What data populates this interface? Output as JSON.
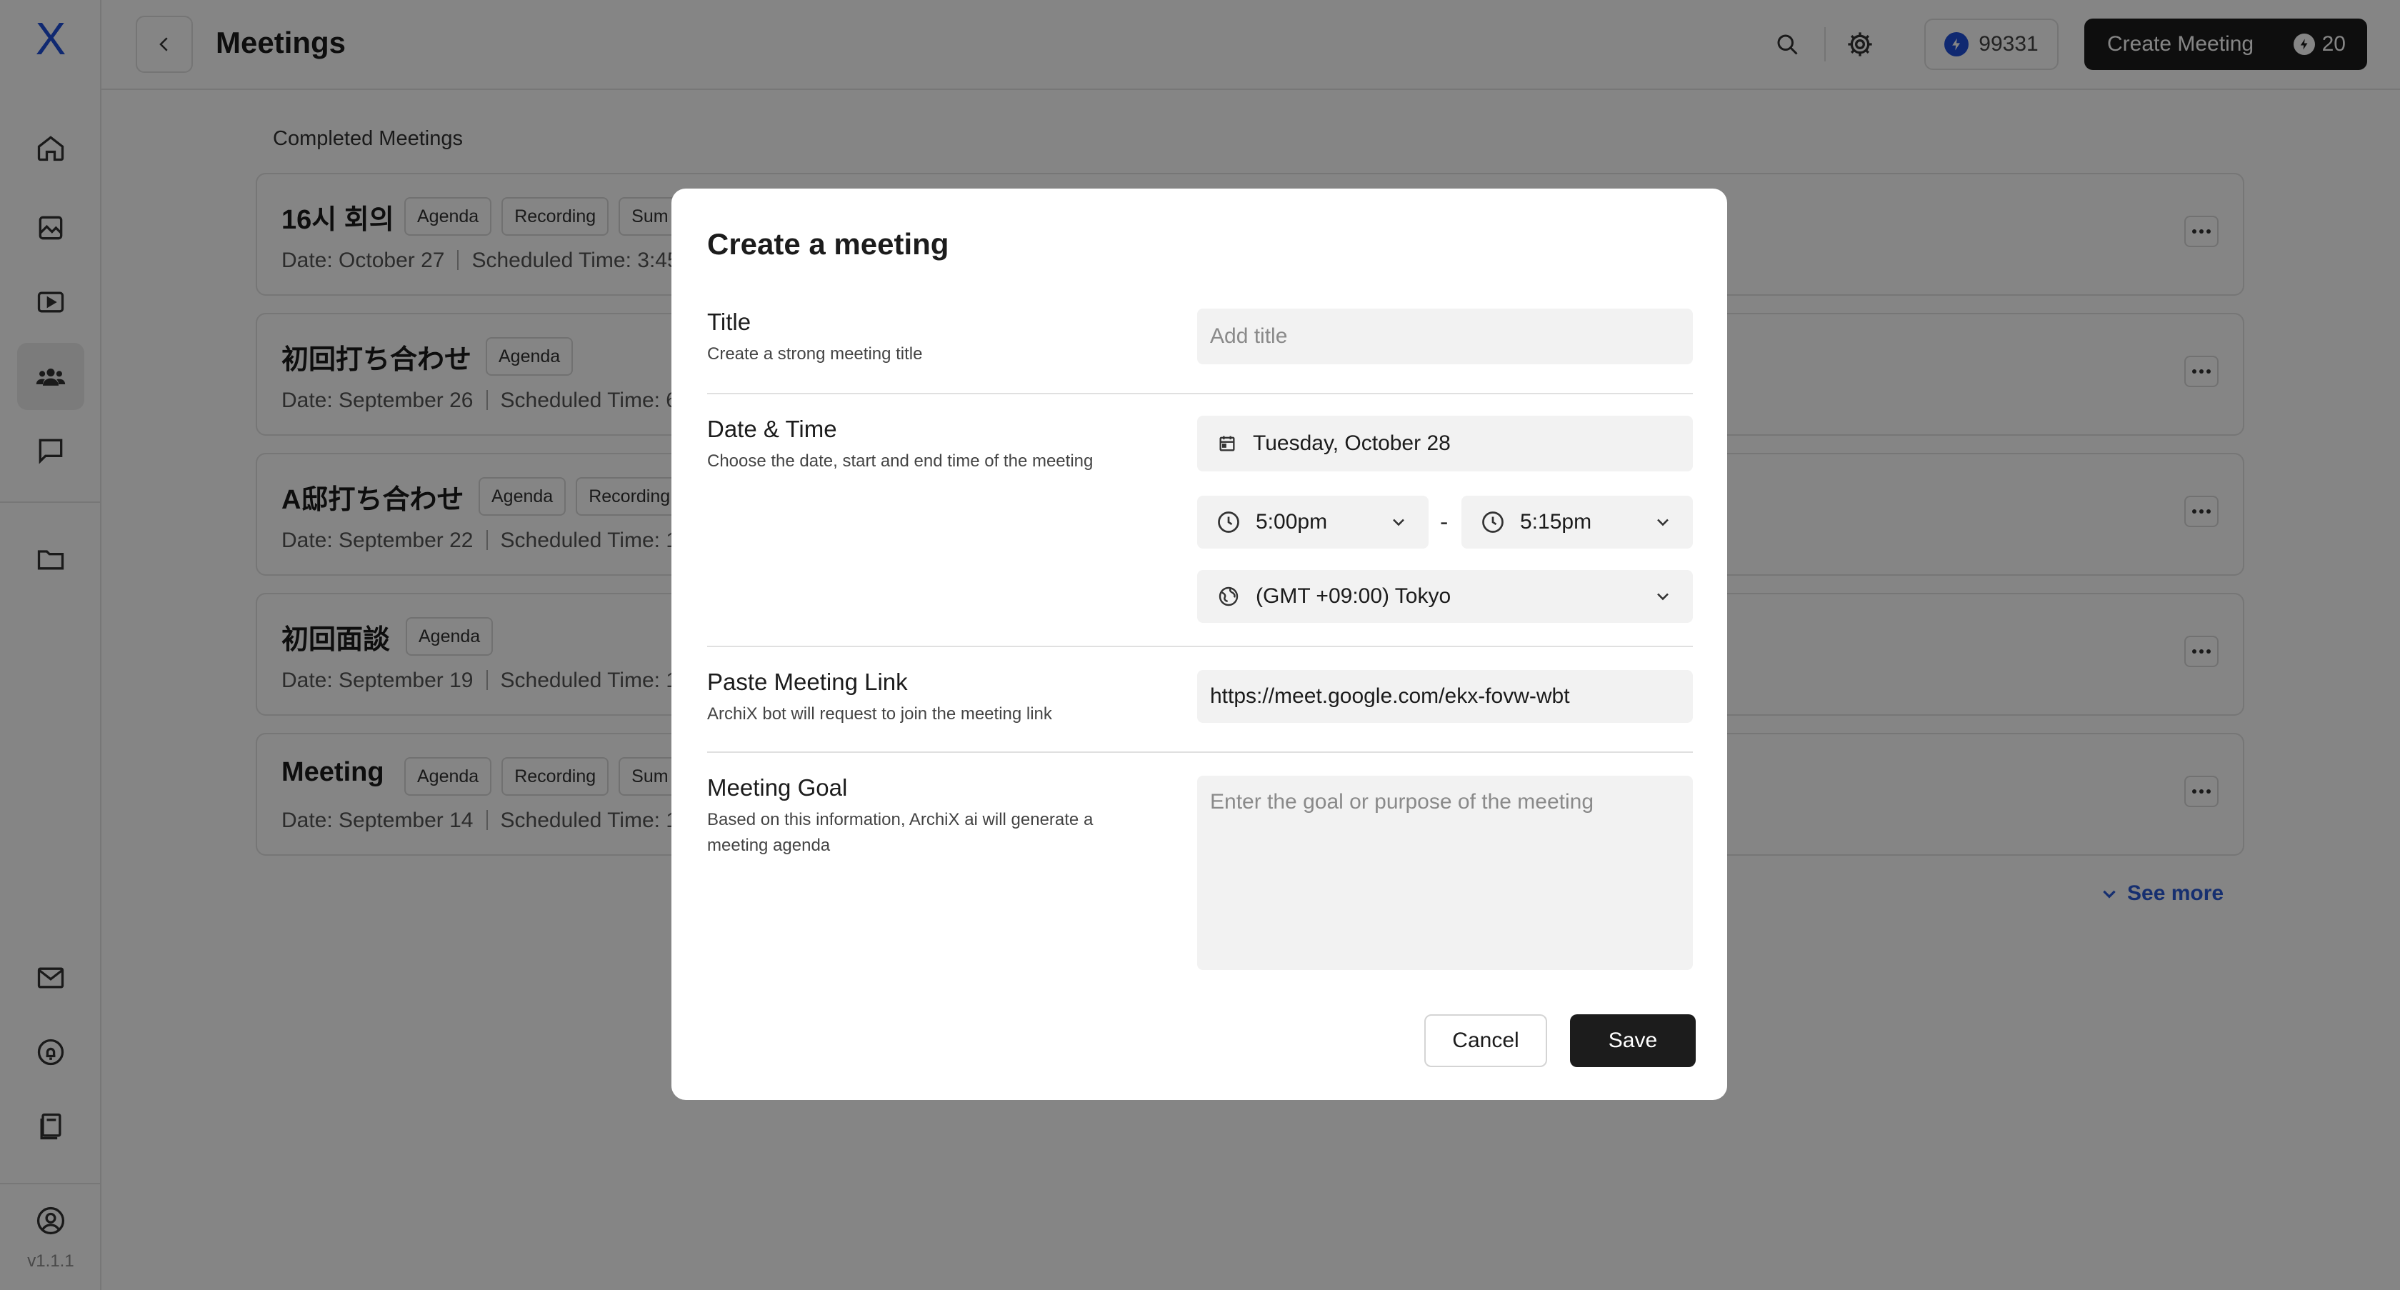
{
  "app": {
    "logo": "X",
    "version": "v1.1.1"
  },
  "sidebar": {
    "items": [
      {
        "name": "home",
        "icon": "home-icon"
      },
      {
        "name": "images",
        "icon": "image-icon"
      },
      {
        "name": "videos",
        "icon": "play-icon"
      },
      {
        "name": "meetings",
        "icon": "users-icon",
        "active": true
      },
      {
        "name": "chat",
        "icon": "chat-icon"
      },
      {
        "name": "files",
        "icon": "folder-icon"
      },
      {
        "name": "mail",
        "icon": "mail-icon"
      },
      {
        "name": "notifications",
        "icon": "bell-icon"
      },
      {
        "name": "docs",
        "icon": "document-icon"
      },
      {
        "name": "profile",
        "icon": "user-circle-icon"
      }
    ]
  },
  "header": {
    "title": "Meetings",
    "credits": "99331",
    "create_label": "Create Meeting",
    "create_cost": "20",
    "accent": "#1f4fd8"
  },
  "list": {
    "section_title": "Completed Meetings",
    "see_more": "See more",
    "meetings": [
      {
        "name": "16시 회의",
        "tags": [
          "Agenda",
          "Recording",
          "Sum"
        ],
        "date": "Date: October 27",
        "time": "Scheduled Time: 3:45"
      },
      {
        "name": "初回打ち合わせ",
        "tags": [
          "Agenda"
        ],
        "date": "Date: September 26",
        "time": "Scheduled Time: 6"
      },
      {
        "name": "A邸打ち合わせ",
        "tags": [
          "Agenda",
          "Recording"
        ],
        "date": "Date: September 22",
        "time": "Scheduled Time: 1"
      },
      {
        "name": "初回面談",
        "tags": [
          "Agenda"
        ],
        "date": "Date: September 19",
        "time": "Scheduled Time: 1:"
      },
      {
        "name": "Meeting",
        "tags": [
          "Agenda",
          "Recording",
          "Sum"
        ],
        "date": "Date: September 14",
        "time": "Scheduled Time: 1:"
      }
    ]
  },
  "modal": {
    "title": "Create a meeting",
    "title_field": {
      "label": "Title",
      "sub": "Create a strong meeting title",
      "placeholder": "Add title",
      "value": ""
    },
    "datetime": {
      "label": "Date & Time",
      "sub": "Choose the date, start and end time of the meeting",
      "date": "Tuesday, October 28",
      "start": "5:00pm",
      "end": "5:15pm",
      "separator": "-",
      "timezone": "(GMT +09:00) Tokyo"
    },
    "link": {
      "label": "Paste Meeting Link",
      "sub": "ArchiX bot will request to join the meeting link",
      "value": "https://meet.google.com/ekx-fovw-wbt"
    },
    "goal": {
      "label": "Meeting Goal",
      "sub": "Based on this information, ArchiX ai will generate a meeting agenda",
      "placeholder": "Enter the goal or purpose of the meeting"
    },
    "cancel_label": "Cancel",
    "save_label": "Save"
  }
}
